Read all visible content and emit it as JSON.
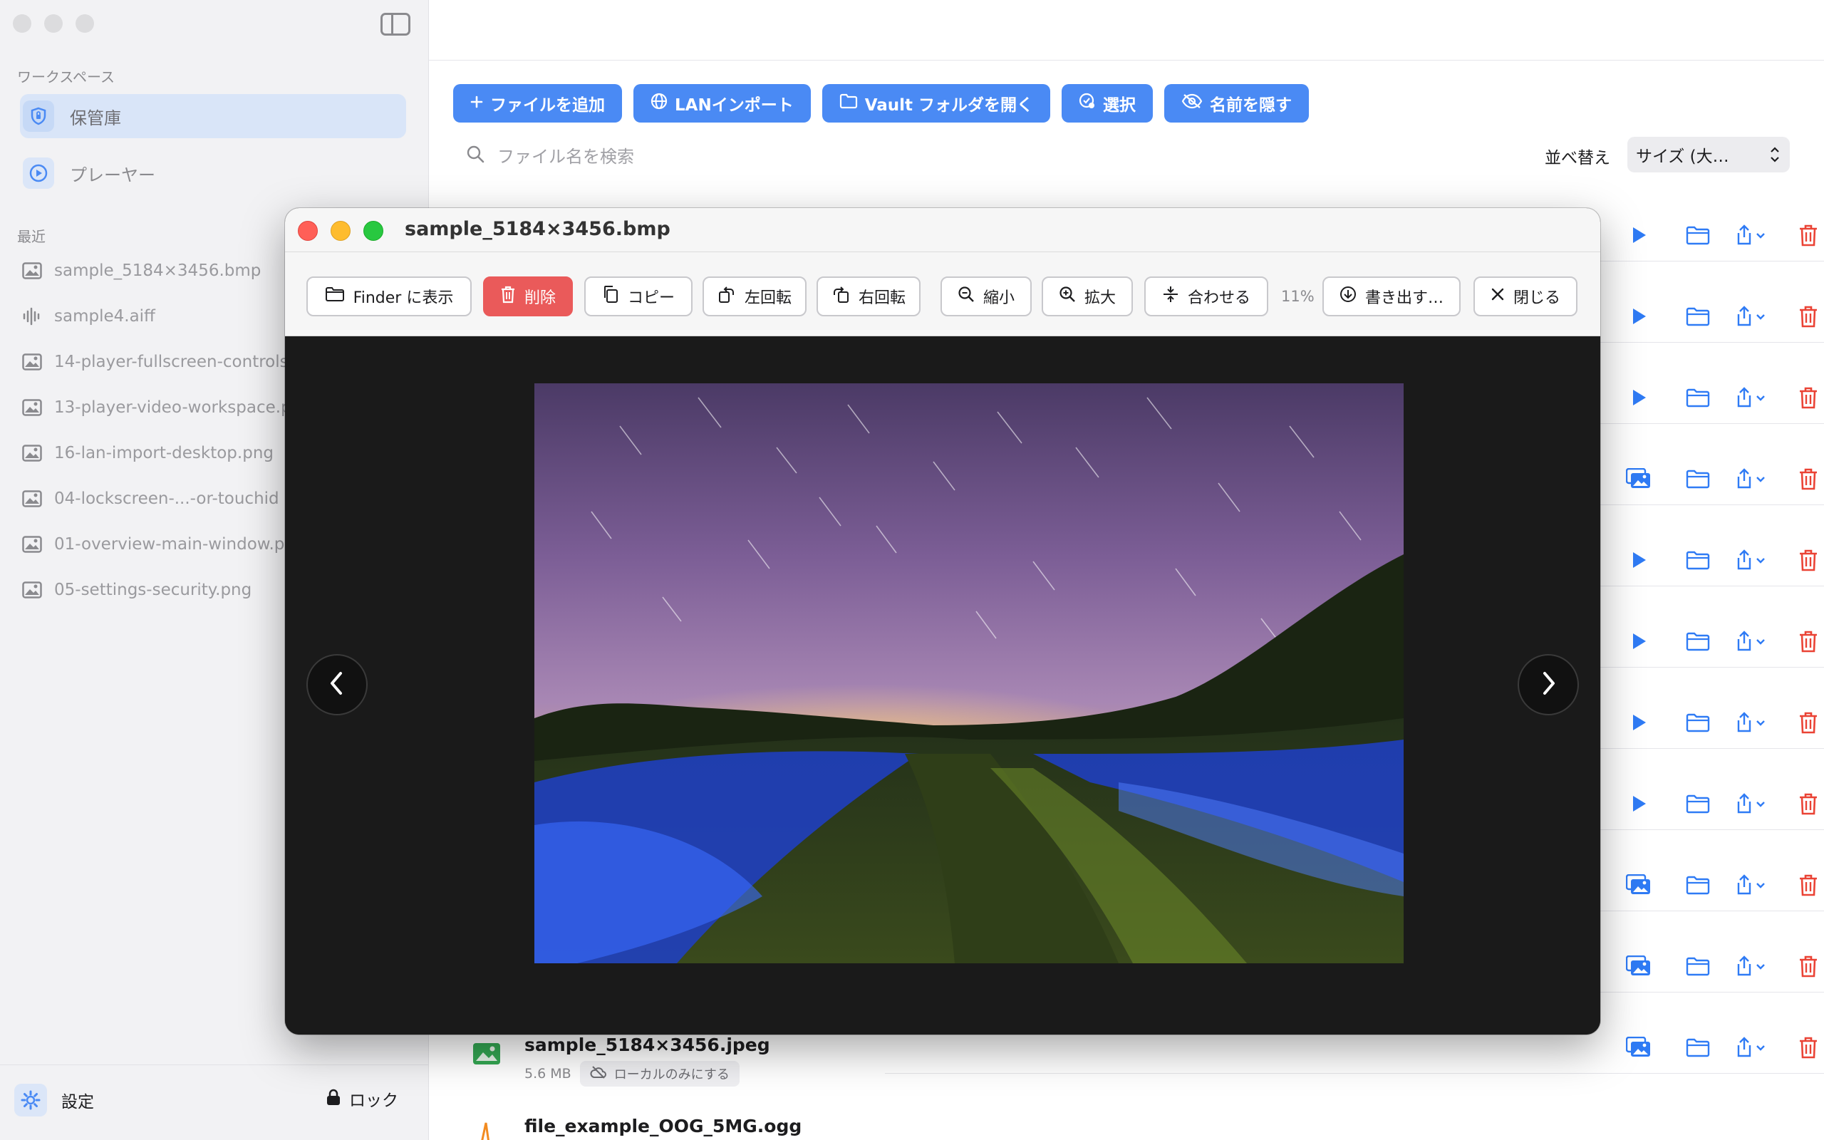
{
  "sidebar": {
    "workspace_label": "ワークスペース",
    "nav": [
      {
        "label": "保管庫",
        "icon": "shield-icon",
        "active": true
      },
      {
        "label": "プレーヤー",
        "icon": "play-circle-icon",
        "active": false
      }
    ],
    "recent_label": "最近",
    "recent": [
      {
        "label": "sample_5184×3456.bmp",
        "icon": "image-icon"
      },
      {
        "label": "sample4.aiff",
        "icon": "waveform-icon"
      },
      {
        "label": "14-player-fullscreen-controls",
        "icon": "image-icon"
      },
      {
        "label": "13-player-video-workspace.p",
        "icon": "image-icon"
      },
      {
        "label": "16-lan-import-desktop.png",
        "icon": "image-icon"
      },
      {
        "label": "04-lockscreen-...-or-touchid",
        "icon": "image-icon"
      },
      {
        "label": "01-overview-main-window.pr",
        "icon": "image-icon"
      },
      {
        "label": "05-settings-security.png",
        "icon": "image-icon"
      }
    ],
    "settings_label": "設定",
    "lock_label": "ロック"
  },
  "toolbar": {
    "add_file": "ファイルを追加",
    "lan_import": "LANインポート",
    "open_vault": "Vault フォルダを開く",
    "select": "選択",
    "hide_names": "名前を隠す"
  },
  "search": {
    "placeholder": "ファイル名を検索"
  },
  "sort": {
    "label": "並べ替え",
    "value": "サイズ (大…"
  },
  "file_rows": [
    {
      "name": "sample_5184×3456.jpeg",
      "size": "5.6 MB",
      "sync_label": "ローカルのみにする"
    },
    {
      "name": "file_example_OOG_5MG.ogg"
    }
  ],
  "row_primary_actions": [
    "play",
    "play",
    "play",
    "gallery",
    "play",
    "play",
    "play",
    "play",
    "gallery",
    "gallery",
    "gallery"
  ],
  "viewer": {
    "title": "sample_5184×3456.bmp",
    "buttons": {
      "show_in_finder": "Finder に表示",
      "delete": "削除",
      "copy": "コピー",
      "rotate_left": "左回転",
      "rotate_right": "右回転",
      "zoom_out": "縮小",
      "zoom_in": "拡大",
      "fit": "合わせる",
      "export": "書き出す…",
      "close": "閉じる"
    },
    "zoom": "11%"
  },
  "colors": {
    "accent": "#4a8af4",
    "danger": "#ea5a5a",
    "sidebar_active": "#d9e5f8"
  }
}
